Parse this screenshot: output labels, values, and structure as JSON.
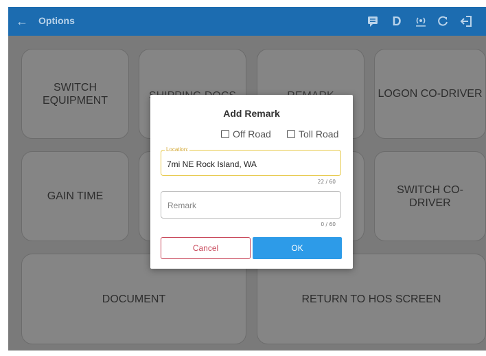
{
  "appbar": {
    "title": "Options",
    "icons": [
      "back-arrow-icon",
      "message-icon",
      "d-status-icon",
      "broadcast-icon",
      "refresh-icon",
      "logout-icon"
    ],
    "d_label": "D",
    "color": "#1c6cb0"
  },
  "tiles": {
    "switch_equipment": "SWITCH\nEQUIPMENT",
    "shipping_docs": "SHIPPING DOCS",
    "remark": "REMARK",
    "logon_co_driver": "LOGON CO-DRIVER",
    "gain_time": "GAIN TIME",
    "switch_co_driver": "SWITCH CO-\nDRIVER",
    "document": "DOCUMENT",
    "return_to_hos": "RETURN TO HOS SCREEN"
  },
  "dialog": {
    "title": "Add Remark",
    "off_road_label": "Off Road",
    "toll_road_label": "Toll Road",
    "location": {
      "label": "Location:",
      "value": "7mi NE Rock Island, WA",
      "counter": "22 / 60"
    },
    "remark": {
      "placeholder": "Remark",
      "counter": "0 / 60"
    },
    "cancel_label": "Cancel",
    "ok_label": "OK",
    "colors": {
      "cancel": "#c8475a",
      "ok": "#2d9be8",
      "focus": "#e7c94a"
    }
  }
}
